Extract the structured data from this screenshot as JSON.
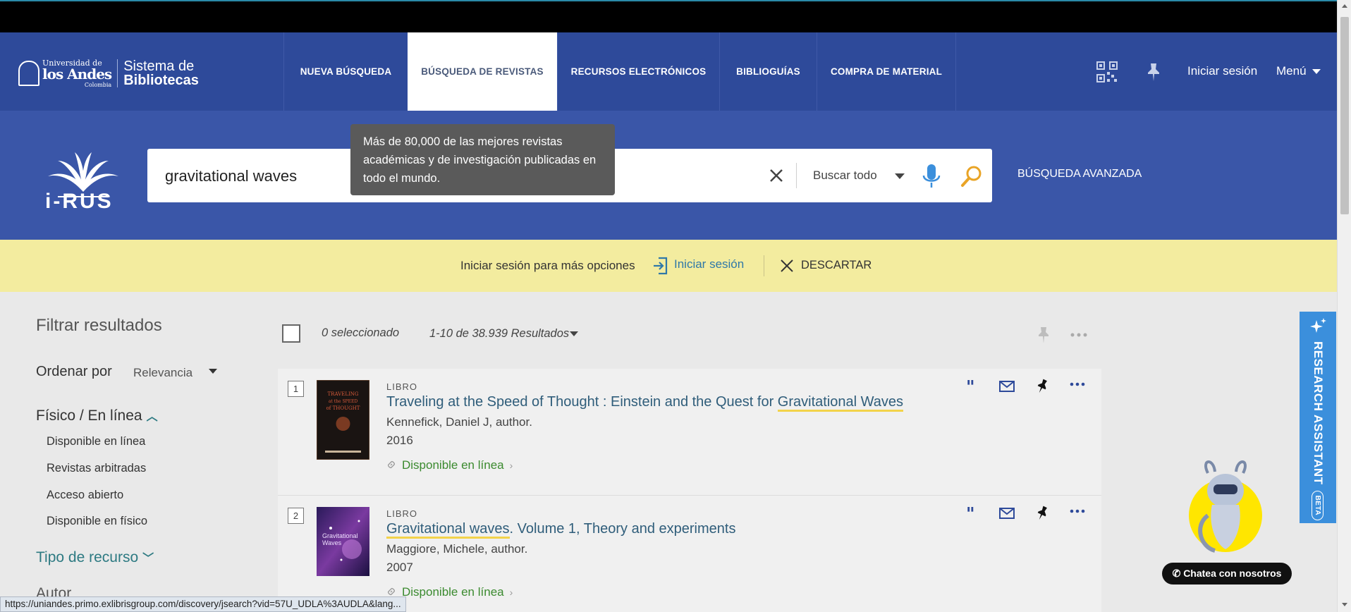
{
  "logo": {
    "university_small": "Universidad de",
    "university_big": "los Andes",
    "country": "Colombia",
    "system_line1": "Sistema de",
    "system_line2": "Bibliotecas"
  },
  "nav": {
    "tabs": [
      {
        "label": "NUEVA BÚSQUEDA",
        "active": false
      },
      {
        "label": "BÚSQUEDA DE REVISTAS",
        "active": true
      },
      {
        "label": "RECURSOS ELECTRÓNICOS",
        "active": false
      },
      {
        "label": "BIBLIOGUÍAS",
        "active": false
      },
      {
        "label": "COMPRA DE MATERIAL",
        "active": false
      }
    ],
    "signin": "Iniciar sesión",
    "menu": "Menú"
  },
  "brand": {
    "name": "i-RUS"
  },
  "search": {
    "query": "gravitational waves",
    "scope": "Buscar todo",
    "advanced": "BÚSQUEDA AVANZADA"
  },
  "tooltip": {
    "text": "Más de 80,000 de las mejores revistas académicas y de investigación publicadas en todo el mundo."
  },
  "notice": {
    "text": "Iniciar sesión para más opciones",
    "login": "Iniciar sesión",
    "dismiss": "DESCARTAR"
  },
  "filters": {
    "title": "Filtrar resultados",
    "sort_label": "Ordenar por",
    "sort_value": "Relevancia",
    "physical_online": "Físico / En línea",
    "physical_online_items": [
      "Disponible en línea",
      "Revistas arbitradas",
      "Acceso abierto",
      "Disponible en físico"
    ],
    "resource_type": "Tipo de recurso",
    "author": "Autor"
  },
  "results": {
    "selected": "0 seleccionado",
    "count": "1-10 de 38.939 Resultados",
    "items": [
      {
        "num": "1",
        "type": "LIBRO",
        "title_plain": "Traveling at the Speed of Thought : Einstein and the Quest for ",
        "title_highlight": "Gravitational Waves",
        "title_rest": "",
        "author": "Kennefick, Daniel J, author.",
        "year": "2016",
        "availability": "Disponible en línea",
        "cover_text": "TRAVELING at the SPEED of THOUGHT"
      },
      {
        "num": "2",
        "type": "LIBRO",
        "title_plain": "",
        "title_highlight": "Gravitational waves",
        "title_rest": ". Volume 1, Theory and experiments",
        "author": "Maggiore, Michele, author.",
        "year": "2007",
        "availability": "Disponible en línea",
        "cover_text": "Gravitational Waves"
      }
    ]
  },
  "assistant": {
    "label": "RESEARCH ASSISTANT",
    "beta": "BETA"
  },
  "chat": {
    "label": "Chatea con nosotros"
  },
  "statusbar": {
    "url": "https://uniandes.primo.exlibrisgroup.com/discovery/jsearch?vid=57U_UDLA%3AUDLA&lang..."
  },
  "colors": {
    "nav_bg": "#2e4a9a",
    "search_band": "#3a56a8",
    "notice_bg": "#f3ec9f",
    "link_blue": "#2f78a8",
    "available_green": "#3b8a2f",
    "teal": "#2d7a82",
    "highlight": "#f3d34a",
    "assistant_blue": "#3b8fdc"
  }
}
